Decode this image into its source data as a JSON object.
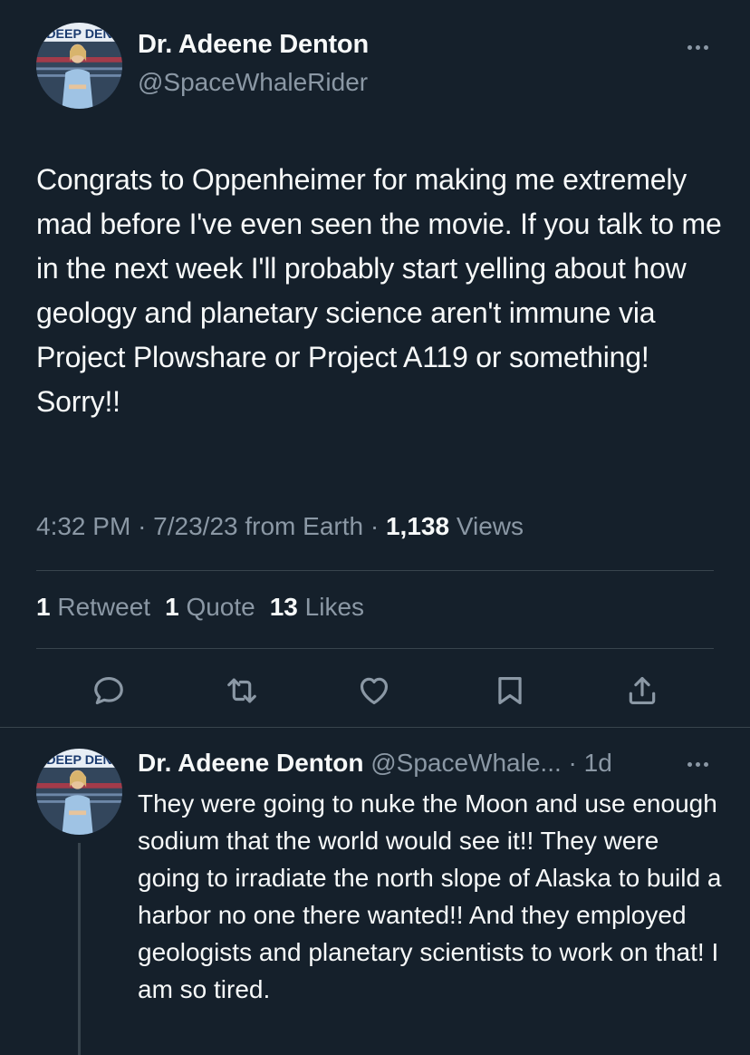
{
  "main_tweet": {
    "author_name": "Dr. Adeene Denton",
    "author_handle": "@SpaceWhaleRider",
    "avatar_banner_text": "DEEP DEN",
    "text": "Congrats to Oppenheimer for making me extremely mad before I've even seen the movie. If you talk to me in the next week I'll probably start yelling about how geology and planetary science aren't immune via Project Plowshare or Project A119 or something! Sorry!!",
    "time": "4:32 PM",
    "date": "7/23/23",
    "source": "from Earth",
    "views_count": "1,138",
    "views_label": "Views",
    "retweets_count": "1",
    "retweets_label": "Retweet",
    "quotes_count": "1",
    "quotes_label": "Quote",
    "likes_count": "13",
    "likes_label": "Likes"
  },
  "actions": [
    "reply-icon",
    "retweet-icon",
    "like-icon",
    "bookmark-icon",
    "share-icon"
  ],
  "reply": {
    "author_name": "Dr. Adeene Denton",
    "author_handle": "@SpaceWhale...",
    "separator": "·",
    "age": "1d",
    "text": "They were going to nuke the Moon and use enough sodium that the world would see it!! They were going to irradiate the north slope of Alaska to build a harbor no one there wanted!! And they employed geologists and planetary scientists to work on that! I am so tired."
  },
  "colors": {
    "background": "#15202b",
    "primary_text": "#f7f9f9",
    "secondary_text": "#8b98a5",
    "divider": "#38444d"
  }
}
